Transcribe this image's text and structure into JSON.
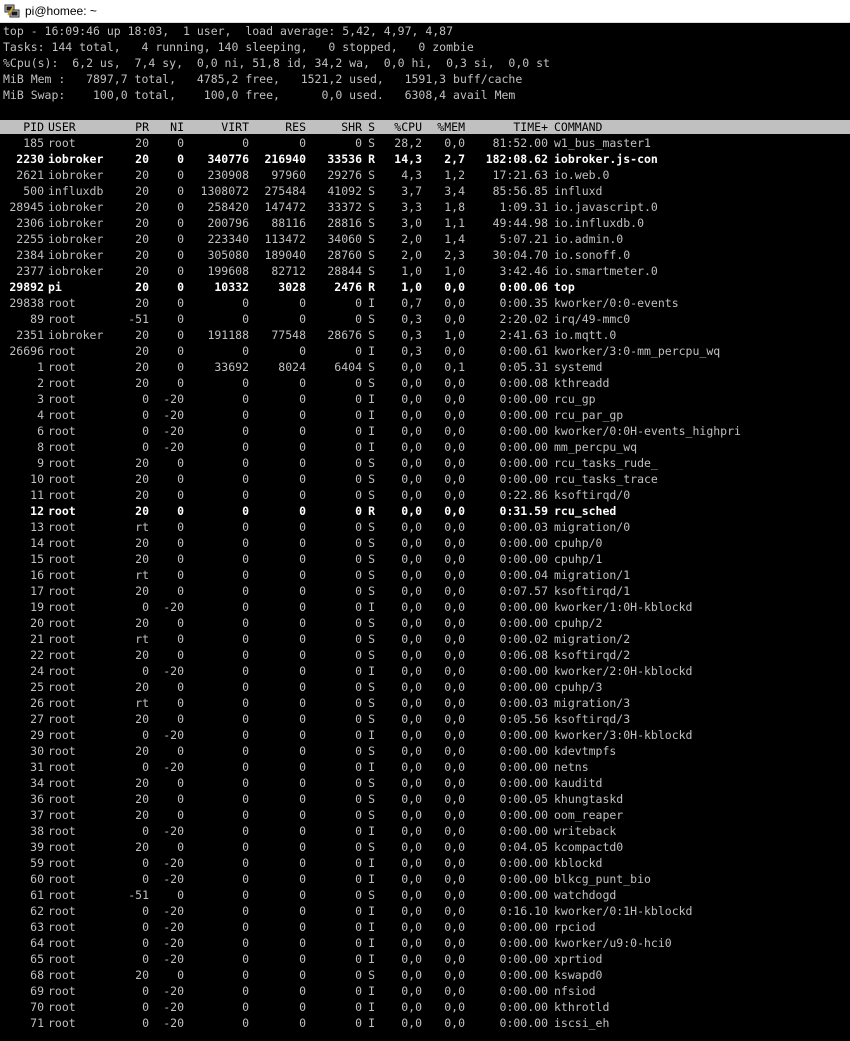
{
  "window": {
    "title": "pi@homee: ~"
  },
  "summary": [
    "top - 16:09:46 up 18:03,  1 user,  load average: 5,42, 4,97, 4,87",
    "Tasks: 144 total,   4 running, 140 sleeping,   0 stopped,   0 zombie",
    "%Cpu(s):  6,2 us,  7,4 sy,  0,0 ni, 51,8 id, 34,2 wa,  0,0 hi,  0,3 si,  0,0 st",
    "MiB Mem :   7897,7 total,   4785,2 free,   1521,2 used,   1591,3 buff/cache",
    "MiB Swap:    100,0 total,    100,0 free,      0,0 used.   6308,4 avail Mem"
  ],
  "columns": [
    "PID",
    "USER",
    "PR",
    "NI",
    "VIRT",
    "RES",
    "SHR",
    "S",
    "%CPU",
    "%MEM",
    "TIME+",
    "COMMAND"
  ],
  "processes": [
    {
      "pid": "185",
      "user": "root",
      "pr": "20",
      "ni": "0",
      "virt": "0",
      "res": "0",
      "shr": "0",
      "s": "S",
      "cpu": "28,2",
      "mem": "0,0",
      "time": "81:52.00",
      "cmd": "w1_bus_master1",
      "bold": false
    },
    {
      "pid": "2230",
      "user": "iobroker",
      "pr": "20",
      "ni": "0",
      "virt": "340776",
      "res": "216940",
      "shr": "33536",
      "s": "R",
      "cpu": "14,3",
      "mem": "2,7",
      "time": "182:08.62",
      "cmd": "iobroker.js-con",
      "bold": true
    },
    {
      "pid": "2621",
      "user": "iobroker",
      "pr": "20",
      "ni": "0",
      "virt": "230908",
      "res": "97960",
      "shr": "29276",
      "s": "S",
      "cpu": "4,3",
      "mem": "1,2",
      "time": "17:21.63",
      "cmd": "io.web.0",
      "bold": false
    },
    {
      "pid": "500",
      "user": "influxdb",
      "pr": "20",
      "ni": "0",
      "virt": "1308072",
      "res": "275484",
      "shr": "41092",
      "s": "S",
      "cpu": "3,7",
      "mem": "3,4",
      "time": "85:56.85",
      "cmd": "influxd",
      "bold": false
    },
    {
      "pid": "28945",
      "user": "iobroker",
      "pr": "20",
      "ni": "0",
      "virt": "258420",
      "res": "147472",
      "shr": "33372",
      "s": "S",
      "cpu": "3,3",
      "mem": "1,8",
      "time": "1:09.31",
      "cmd": "io.javascript.0",
      "bold": false
    },
    {
      "pid": "2306",
      "user": "iobroker",
      "pr": "20",
      "ni": "0",
      "virt": "200796",
      "res": "88116",
      "shr": "28816",
      "s": "S",
      "cpu": "3,0",
      "mem": "1,1",
      "time": "49:44.98",
      "cmd": "io.influxdb.0",
      "bold": false
    },
    {
      "pid": "2255",
      "user": "iobroker",
      "pr": "20",
      "ni": "0",
      "virt": "223340",
      "res": "113472",
      "shr": "34060",
      "s": "S",
      "cpu": "2,0",
      "mem": "1,4",
      "time": "5:07.21",
      "cmd": "io.admin.0",
      "bold": false
    },
    {
      "pid": "2384",
      "user": "iobroker",
      "pr": "20",
      "ni": "0",
      "virt": "305080",
      "res": "189040",
      "shr": "28760",
      "s": "S",
      "cpu": "2,0",
      "mem": "2,3",
      "time": "30:04.70",
      "cmd": "io.sonoff.0",
      "bold": false
    },
    {
      "pid": "2377",
      "user": "iobroker",
      "pr": "20",
      "ni": "0",
      "virt": "199608",
      "res": "82712",
      "shr": "28844",
      "s": "S",
      "cpu": "1,0",
      "mem": "1,0",
      "time": "3:42.46",
      "cmd": "io.smartmeter.0",
      "bold": false
    },
    {
      "pid": "29892",
      "user": "pi",
      "pr": "20",
      "ni": "0",
      "virt": "10332",
      "res": "3028",
      "shr": "2476",
      "s": "R",
      "cpu": "1,0",
      "mem": "0,0",
      "time": "0:00.06",
      "cmd": "top",
      "bold": true
    },
    {
      "pid": "29838",
      "user": "root",
      "pr": "20",
      "ni": "0",
      "virt": "0",
      "res": "0",
      "shr": "0",
      "s": "I",
      "cpu": "0,7",
      "mem": "0,0",
      "time": "0:00.35",
      "cmd": "kworker/0:0-events",
      "bold": false
    },
    {
      "pid": "89",
      "user": "root",
      "pr": "-51",
      "ni": "0",
      "virt": "0",
      "res": "0",
      "shr": "0",
      "s": "S",
      "cpu": "0,3",
      "mem": "0,0",
      "time": "2:20.02",
      "cmd": "irq/49-mmc0",
      "bold": false
    },
    {
      "pid": "2351",
      "user": "iobroker",
      "pr": "20",
      "ni": "0",
      "virt": "191188",
      "res": "77548",
      "shr": "28676",
      "s": "S",
      "cpu": "0,3",
      "mem": "1,0",
      "time": "2:41.63",
      "cmd": "io.mqtt.0",
      "bold": false
    },
    {
      "pid": "26696",
      "user": "root",
      "pr": "20",
      "ni": "0",
      "virt": "0",
      "res": "0",
      "shr": "0",
      "s": "I",
      "cpu": "0,3",
      "mem": "0,0",
      "time": "0:00.61",
      "cmd": "kworker/3:0-mm_percpu_wq",
      "bold": false
    },
    {
      "pid": "1",
      "user": "root",
      "pr": "20",
      "ni": "0",
      "virt": "33692",
      "res": "8024",
      "shr": "6404",
      "s": "S",
      "cpu": "0,0",
      "mem": "0,1",
      "time": "0:05.31",
      "cmd": "systemd",
      "bold": false
    },
    {
      "pid": "2",
      "user": "root",
      "pr": "20",
      "ni": "0",
      "virt": "0",
      "res": "0",
      "shr": "0",
      "s": "S",
      "cpu": "0,0",
      "mem": "0,0",
      "time": "0:00.08",
      "cmd": "kthreadd",
      "bold": false
    },
    {
      "pid": "3",
      "user": "root",
      "pr": "0",
      "ni": "-20",
      "virt": "0",
      "res": "0",
      "shr": "0",
      "s": "I",
      "cpu": "0,0",
      "mem": "0,0",
      "time": "0:00.00",
      "cmd": "rcu_gp",
      "bold": false
    },
    {
      "pid": "4",
      "user": "root",
      "pr": "0",
      "ni": "-20",
      "virt": "0",
      "res": "0",
      "shr": "0",
      "s": "I",
      "cpu": "0,0",
      "mem": "0,0",
      "time": "0:00.00",
      "cmd": "rcu_par_gp",
      "bold": false
    },
    {
      "pid": "6",
      "user": "root",
      "pr": "0",
      "ni": "-20",
      "virt": "0",
      "res": "0",
      "shr": "0",
      "s": "I",
      "cpu": "0,0",
      "mem": "0,0",
      "time": "0:00.00",
      "cmd": "kworker/0:0H-events_highpri",
      "bold": false
    },
    {
      "pid": "8",
      "user": "root",
      "pr": "0",
      "ni": "-20",
      "virt": "0",
      "res": "0",
      "shr": "0",
      "s": "I",
      "cpu": "0,0",
      "mem": "0,0",
      "time": "0:00.00",
      "cmd": "mm_percpu_wq",
      "bold": false
    },
    {
      "pid": "9",
      "user": "root",
      "pr": "20",
      "ni": "0",
      "virt": "0",
      "res": "0",
      "shr": "0",
      "s": "S",
      "cpu": "0,0",
      "mem": "0,0",
      "time": "0:00.00",
      "cmd": "rcu_tasks_rude_",
      "bold": false
    },
    {
      "pid": "10",
      "user": "root",
      "pr": "20",
      "ni": "0",
      "virt": "0",
      "res": "0",
      "shr": "0",
      "s": "S",
      "cpu": "0,0",
      "mem": "0,0",
      "time": "0:00.00",
      "cmd": "rcu_tasks_trace",
      "bold": false
    },
    {
      "pid": "11",
      "user": "root",
      "pr": "20",
      "ni": "0",
      "virt": "0",
      "res": "0",
      "shr": "0",
      "s": "S",
      "cpu": "0,0",
      "mem": "0,0",
      "time": "0:22.86",
      "cmd": "ksoftirqd/0",
      "bold": false
    },
    {
      "pid": "12",
      "user": "root",
      "pr": "20",
      "ni": "0",
      "virt": "0",
      "res": "0",
      "shr": "0",
      "s": "R",
      "cpu": "0,0",
      "mem": "0,0",
      "time": "0:31.59",
      "cmd": "rcu_sched",
      "bold": true
    },
    {
      "pid": "13",
      "user": "root",
      "pr": "rt",
      "ni": "0",
      "virt": "0",
      "res": "0",
      "shr": "0",
      "s": "S",
      "cpu": "0,0",
      "mem": "0,0",
      "time": "0:00.03",
      "cmd": "migration/0",
      "bold": false
    },
    {
      "pid": "14",
      "user": "root",
      "pr": "20",
      "ni": "0",
      "virt": "0",
      "res": "0",
      "shr": "0",
      "s": "S",
      "cpu": "0,0",
      "mem": "0,0",
      "time": "0:00.00",
      "cmd": "cpuhp/0",
      "bold": false
    },
    {
      "pid": "15",
      "user": "root",
      "pr": "20",
      "ni": "0",
      "virt": "0",
      "res": "0",
      "shr": "0",
      "s": "S",
      "cpu": "0,0",
      "mem": "0,0",
      "time": "0:00.00",
      "cmd": "cpuhp/1",
      "bold": false
    },
    {
      "pid": "16",
      "user": "root",
      "pr": "rt",
      "ni": "0",
      "virt": "0",
      "res": "0",
      "shr": "0",
      "s": "S",
      "cpu": "0,0",
      "mem": "0,0",
      "time": "0:00.04",
      "cmd": "migration/1",
      "bold": false
    },
    {
      "pid": "17",
      "user": "root",
      "pr": "20",
      "ni": "0",
      "virt": "0",
      "res": "0",
      "shr": "0",
      "s": "S",
      "cpu": "0,0",
      "mem": "0,0",
      "time": "0:07.57",
      "cmd": "ksoftirqd/1",
      "bold": false
    },
    {
      "pid": "19",
      "user": "root",
      "pr": "0",
      "ni": "-20",
      "virt": "0",
      "res": "0",
      "shr": "0",
      "s": "I",
      "cpu": "0,0",
      "mem": "0,0",
      "time": "0:00.00",
      "cmd": "kworker/1:0H-kblockd",
      "bold": false
    },
    {
      "pid": "20",
      "user": "root",
      "pr": "20",
      "ni": "0",
      "virt": "0",
      "res": "0",
      "shr": "0",
      "s": "S",
      "cpu": "0,0",
      "mem": "0,0",
      "time": "0:00.00",
      "cmd": "cpuhp/2",
      "bold": false
    },
    {
      "pid": "21",
      "user": "root",
      "pr": "rt",
      "ni": "0",
      "virt": "0",
      "res": "0",
      "shr": "0",
      "s": "S",
      "cpu": "0,0",
      "mem": "0,0",
      "time": "0:00.02",
      "cmd": "migration/2",
      "bold": false
    },
    {
      "pid": "22",
      "user": "root",
      "pr": "20",
      "ni": "0",
      "virt": "0",
      "res": "0",
      "shr": "0",
      "s": "S",
      "cpu": "0,0",
      "mem": "0,0",
      "time": "0:06.08",
      "cmd": "ksoftirqd/2",
      "bold": false
    },
    {
      "pid": "24",
      "user": "root",
      "pr": "0",
      "ni": "-20",
      "virt": "0",
      "res": "0",
      "shr": "0",
      "s": "I",
      "cpu": "0,0",
      "mem": "0,0",
      "time": "0:00.00",
      "cmd": "kworker/2:0H-kblockd",
      "bold": false
    },
    {
      "pid": "25",
      "user": "root",
      "pr": "20",
      "ni": "0",
      "virt": "0",
      "res": "0",
      "shr": "0",
      "s": "S",
      "cpu": "0,0",
      "mem": "0,0",
      "time": "0:00.00",
      "cmd": "cpuhp/3",
      "bold": false
    },
    {
      "pid": "26",
      "user": "root",
      "pr": "rt",
      "ni": "0",
      "virt": "0",
      "res": "0",
      "shr": "0",
      "s": "S",
      "cpu": "0,0",
      "mem": "0,0",
      "time": "0:00.03",
      "cmd": "migration/3",
      "bold": false
    },
    {
      "pid": "27",
      "user": "root",
      "pr": "20",
      "ni": "0",
      "virt": "0",
      "res": "0",
      "shr": "0",
      "s": "S",
      "cpu": "0,0",
      "mem": "0,0",
      "time": "0:05.56",
      "cmd": "ksoftirqd/3",
      "bold": false
    },
    {
      "pid": "29",
      "user": "root",
      "pr": "0",
      "ni": "-20",
      "virt": "0",
      "res": "0",
      "shr": "0",
      "s": "I",
      "cpu": "0,0",
      "mem": "0,0",
      "time": "0:00.00",
      "cmd": "kworker/3:0H-kblockd",
      "bold": false
    },
    {
      "pid": "30",
      "user": "root",
      "pr": "20",
      "ni": "0",
      "virt": "0",
      "res": "0",
      "shr": "0",
      "s": "S",
      "cpu": "0,0",
      "mem": "0,0",
      "time": "0:00.00",
      "cmd": "kdevtmpfs",
      "bold": false
    },
    {
      "pid": "31",
      "user": "root",
      "pr": "0",
      "ni": "-20",
      "virt": "0",
      "res": "0",
      "shr": "0",
      "s": "I",
      "cpu": "0,0",
      "mem": "0,0",
      "time": "0:00.00",
      "cmd": "netns",
      "bold": false
    },
    {
      "pid": "34",
      "user": "root",
      "pr": "20",
      "ni": "0",
      "virt": "0",
      "res": "0",
      "shr": "0",
      "s": "S",
      "cpu": "0,0",
      "mem": "0,0",
      "time": "0:00.00",
      "cmd": "kauditd",
      "bold": false
    },
    {
      "pid": "36",
      "user": "root",
      "pr": "20",
      "ni": "0",
      "virt": "0",
      "res": "0",
      "shr": "0",
      "s": "S",
      "cpu": "0,0",
      "mem": "0,0",
      "time": "0:00.05",
      "cmd": "khungtaskd",
      "bold": false
    },
    {
      "pid": "37",
      "user": "root",
      "pr": "20",
      "ni": "0",
      "virt": "0",
      "res": "0",
      "shr": "0",
      "s": "S",
      "cpu": "0,0",
      "mem": "0,0",
      "time": "0:00.00",
      "cmd": "oom_reaper",
      "bold": false
    },
    {
      "pid": "38",
      "user": "root",
      "pr": "0",
      "ni": "-20",
      "virt": "0",
      "res": "0",
      "shr": "0",
      "s": "I",
      "cpu": "0,0",
      "mem": "0,0",
      "time": "0:00.00",
      "cmd": "writeback",
      "bold": false
    },
    {
      "pid": "39",
      "user": "root",
      "pr": "20",
      "ni": "0",
      "virt": "0",
      "res": "0",
      "shr": "0",
      "s": "S",
      "cpu": "0,0",
      "mem": "0,0",
      "time": "0:04.05",
      "cmd": "kcompactd0",
      "bold": false
    },
    {
      "pid": "59",
      "user": "root",
      "pr": "0",
      "ni": "-20",
      "virt": "0",
      "res": "0",
      "shr": "0",
      "s": "I",
      "cpu": "0,0",
      "mem": "0,0",
      "time": "0:00.00",
      "cmd": "kblockd",
      "bold": false
    },
    {
      "pid": "60",
      "user": "root",
      "pr": "0",
      "ni": "-20",
      "virt": "0",
      "res": "0",
      "shr": "0",
      "s": "I",
      "cpu": "0,0",
      "mem": "0,0",
      "time": "0:00.00",
      "cmd": "blkcg_punt_bio",
      "bold": false
    },
    {
      "pid": "61",
      "user": "root",
      "pr": "-51",
      "ni": "0",
      "virt": "0",
      "res": "0",
      "shr": "0",
      "s": "S",
      "cpu": "0,0",
      "mem": "0,0",
      "time": "0:00.00",
      "cmd": "watchdogd",
      "bold": false
    },
    {
      "pid": "62",
      "user": "root",
      "pr": "0",
      "ni": "-20",
      "virt": "0",
      "res": "0",
      "shr": "0",
      "s": "I",
      "cpu": "0,0",
      "mem": "0,0",
      "time": "0:16.10",
      "cmd": "kworker/0:1H-kblockd",
      "bold": false
    },
    {
      "pid": "63",
      "user": "root",
      "pr": "0",
      "ni": "-20",
      "virt": "0",
      "res": "0",
      "shr": "0",
      "s": "I",
      "cpu": "0,0",
      "mem": "0,0",
      "time": "0:00.00",
      "cmd": "rpciod",
      "bold": false
    },
    {
      "pid": "64",
      "user": "root",
      "pr": "0",
      "ni": "-20",
      "virt": "0",
      "res": "0",
      "shr": "0",
      "s": "I",
      "cpu": "0,0",
      "mem": "0,0",
      "time": "0:00.00",
      "cmd": "kworker/u9:0-hci0",
      "bold": false
    },
    {
      "pid": "65",
      "user": "root",
      "pr": "0",
      "ni": "-20",
      "virt": "0",
      "res": "0",
      "shr": "0",
      "s": "I",
      "cpu": "0,0",
      "mem": "0,0",
      "time": "0:00.00",
      "cmd": "xprtiod",
      "bold": false
    },
    {
      "pid": "68",
      "user": "root",
      "pr": "20",
      "ni": "0",
      "virt": "0",
      "res": "0",
      "shr": "0",
      "s": "S",
      "cpu": "0,0",
      "mem": "0,0",
      "time": "0:00.00",
      "cmd": "kswapd0",
      "bold": false
    },
    {
      "pid": "69",
      "user": "root",
      "pr": "0",
      "ni": "-20",
      "virt": "0",
      "res": "0",
      "shr": "0",
      "s": "I",
      "cpu": "0,0",
      "mem": "0,0",
      "time": "0:00.00",
      "cmd": "nfsiod",
      "bold": false
    },
    {
      "pid": "70",
      "user": "root",
      "pr": "0",
      "ni": "-20",
      "virt": "0",
      "res": "0",
      "shr": "0",
      "s": "I",
      "cpu": "0,0",
      "mem": "0,0",
      "time": "0:00.00",
      "cmd": "kthrotld",
      "bold": false
    },
    {
      "pid": "71",
      "user": "root",
      "pr": "0",
      "ni": "-20",
      "virt": "0",
      "res": "0",
      "shr": "0",
      "s": "I",
      "cpu": "0,0",
      "mem": "0,0",
      "time": "0:00.00",
      "cmd": "iscsi_eh",
      "bold": false
    }
  ],
  "icons": {
    "title_icon": "putty-terminal-icon"
  },
  "colors": {
    "terminal_bg": "#000000",
    "terminal_fg": "#c0c0c0",
    "header_bg": "#c0c0c0",
    "bold_fg": "#ffffff"
  }
}
